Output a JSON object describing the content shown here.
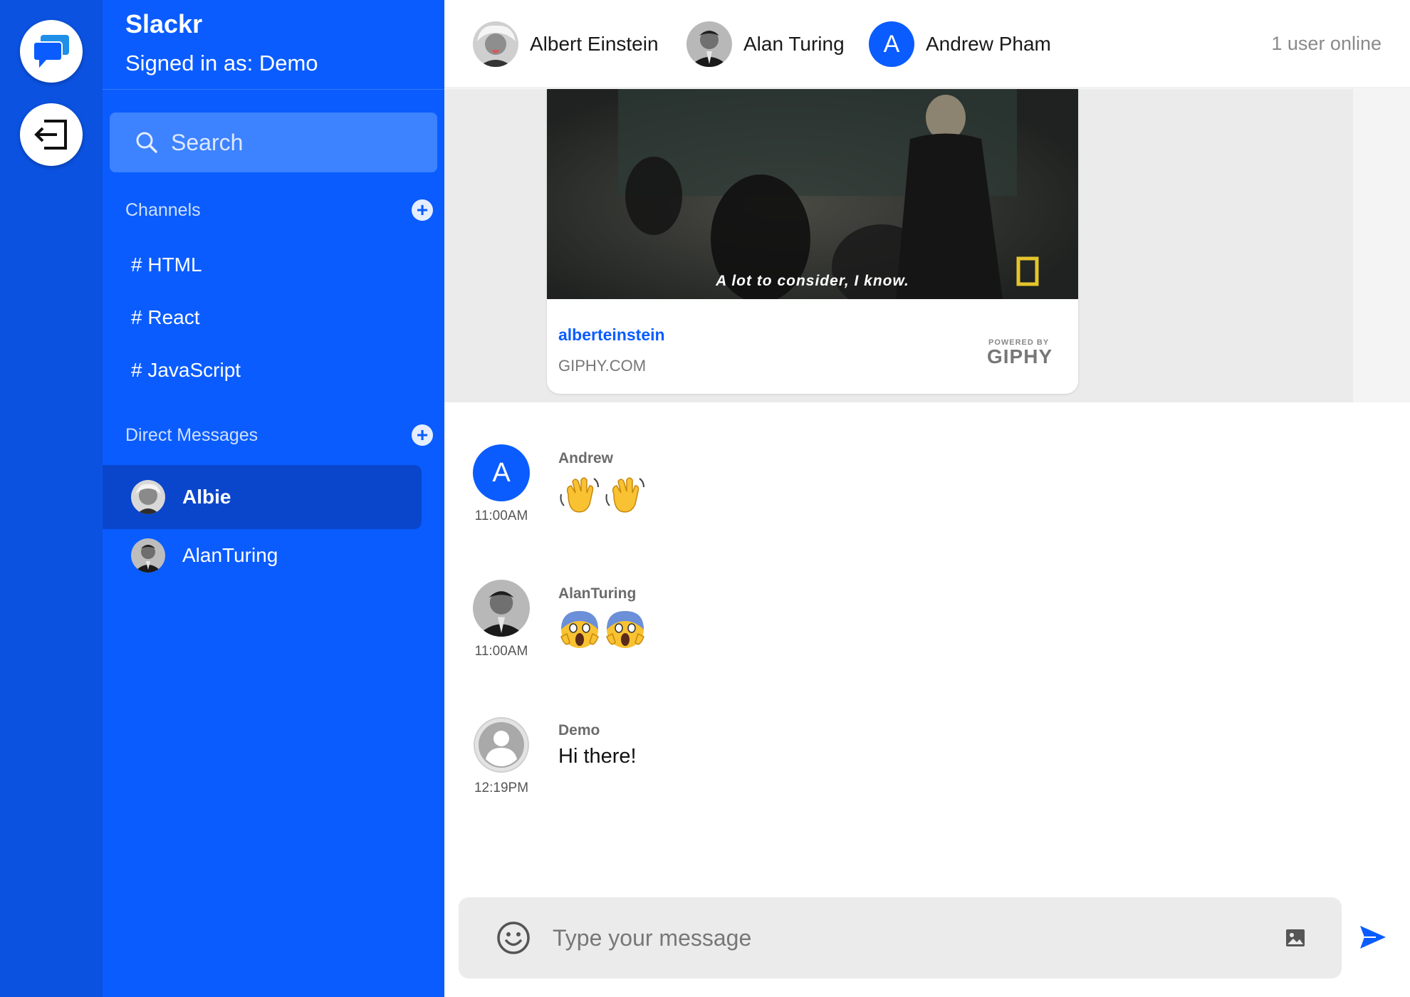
{
  "app": {
    "name": "Slackr",
    "signed_in": "Signed in as: Demo"
  },
  "rail": {
    "icons": [
      "chat-bubbles-icon",
      "logout-icon"
    ]
  },
  "sidebar": {
    "search_label": "Search",
    "channels_title": "Channels",
    "channels": [
      "# HTML",
      "# React",
      "# JavaScript"
    ],
    "dm_title": "Direct Messages",
    "dms": [
      {
        "name": "Albie",
        "active": true
      },
      {
        "name": "AlanTuring",
        "active": false
      }
    ]
  },
  "topbar": {
    "members": [
      {
        "name": "Albert Einstein",
        "avatar": "photo"
      },
      {
        "name": "Alan Turing",
        "avatar": "photo"
      },
      {
        "name": "Andrew Pham",
        "avatar_letter": "A"
      }
    ],
    "online": "1 user online"
  },
  "gif": {
    "caption": "A lot to consider, I know.",
    "title": "alberteinstein",
    "domain": "GIPHY.COM",
    "powered_small": "POWERED BY",
    "powered_big": "GIPHY"
  },
  "messages": [
    {
      "author": "Andrew",
      "time": "11:00AM",
      "avatar_letter": "A",
      "body_emoji": [
        "waving-hands-emoji",
        "waving-hands-emoji"
      ]
    },
    {
      "author": "AlanTuring",
      "time": "11:00AM",
      "body_emoji": [
        "screaming-face-emoji",
        "screaming-face-emoji"
      ]
    },
    {
      "author": "Demo",
      "time": "12:19PM",
      "body": "Hi there!"
    }
  ],
  "composer": {
    "placeholder": "Type your message"
  },
  "colors": {
    "rail": "#0b52e0",
    "sidebar": "#0a5cff",
    "accent": "#0a5cff",
    "active_dm": "#0a46cc"
  }
}
